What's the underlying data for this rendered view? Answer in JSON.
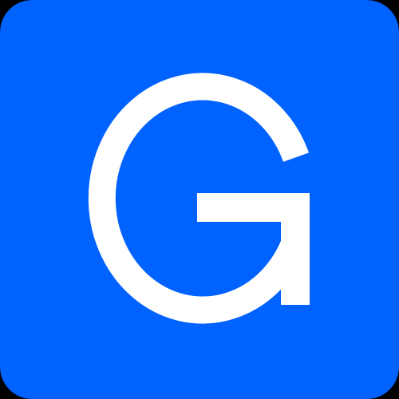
{
  "icon": {
    "name": "letter-g-app-icon",
    "letter": "G",
    "colors": {
      "background": "#0062FF",
      "letter": "#FFFFFF",
      "outer_background": "#000000"
    }
  }
}
